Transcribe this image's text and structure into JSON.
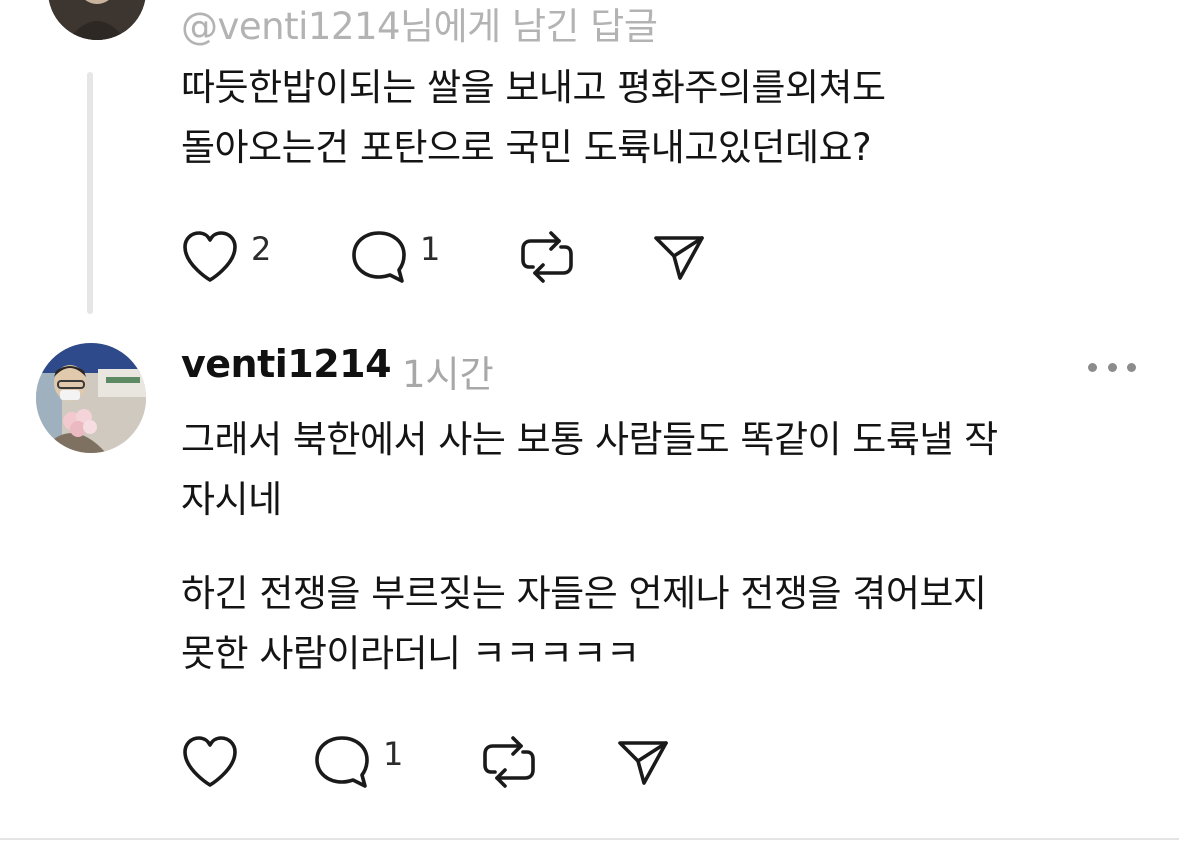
{
  "top_post": {
    "reply_to": "@venti1214님에게 남긴 답글",
    "lines": [
      "따듯한밥이되는 쌀을 보내고 평화주의를외쳐도",
      "돌아오는건 포탄으로 국민 도륙내고있던데요?"
    ],
    "actions": {
      "like_count": "2",
      "comment_count": "1"
    }
  },
  "bottom_post": {
    "username": "venti1214",
    "timestamp": "1시간",
    "paragraph1": [
      "그래서 북한에서 사는 보통 사람들도 똑같이 도륙낼 작",
      "자시네"
    ],
    "paragraph2": [
      "하긴 전쟁을 부르짖는 자들은 언제나 전쟁을 겪어보지",
      "못한 사람이라더니 ㅋㅋㅋㅋㅋ"
    ],
    "actions": {
      "comment_count": "1"
    }
  },
  "icons": {
    "like": "heart-outline-icon",
    "comment": "speech-bubble-icon",
    "repost": "repost-arrows-icon",
    "share": "paper-plane-icon",
    "more": "ellipsis-icon"
  },
  "colors": {
    "text": "#141414",
    "muted": "#a8a8a8",
    "thread_line": "#e6e6e6",
    "icon": "#1a1a1a"
  }
}
